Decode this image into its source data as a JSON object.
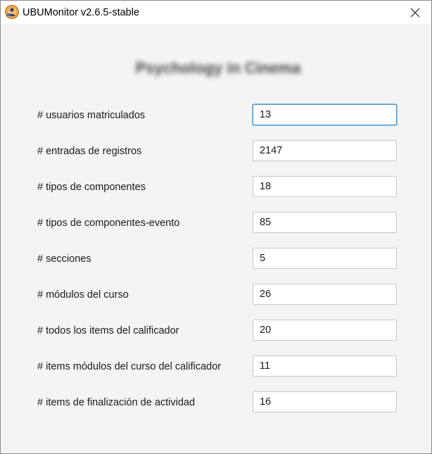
{
  "window": {
    "title": "UBUMonitor v2.6.5-stable",
    "icon": "ubumonitor-app-icon",
    "close_icon": "close-icon"
  },
  "course": {
    "name": "Psychology in Cinema",
    "blurred": true
  },
  "stats": [
    {
      "label": "# usuarios matriculados",
      "value": "13"
    },
    {
      "label": "# entradas de registros",
      "value": "2147"
    },
    {
      "label": "# tipos de componentes",
      "value": "18"
    },
    {
      "label": "# tipos de componentes-evento",
      "value": "85"
    },
    {
      "label": "# secciones",
      "value": "5"
    },
    {
      "label": "# módulos del curso",
      "value": "26"
    },
    {
      "label": "# todos los items del calificador",
      "value": "20"
    },
    {
      "label": "# items módulos del curso del calificador",
      "value": "11"
    },
    {
      "label": "# items de finalización de actividad",
      "value": "16"
    }
  ],
  "colors": {
    "focus_border": "#3b9ae0",
    "window_bg": "#f4f4f4",
    "titlebar_bg": "#ffffff"
  }
}
